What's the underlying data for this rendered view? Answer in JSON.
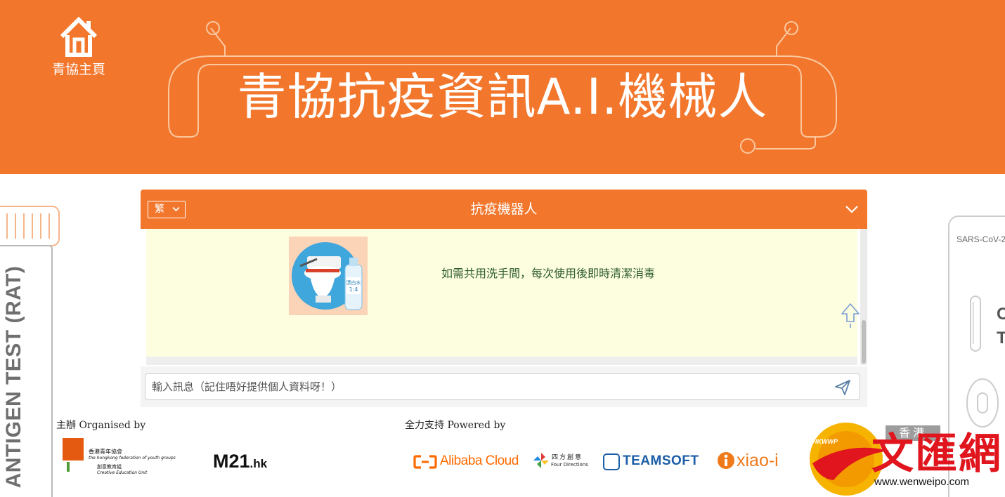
{
  "banner": {
    "home_label": "青協主頁",
    "title": "青協抗疫資訊A.I.機械人",
    "background": "#f2772d"
  },
  "chat": {
    "language": "繁",
    "title": "抗疫機器人",
    "message": {
      "image_badge": "漂白水",
      "image_ratio": "1:4",
      "text": "如需共用洗手間，每次使用後即時清潔消毒"
    },
    "input_placeholder": "輸入訊息（記住唔好提供個人資料呀！）"
  },
  "decor": {
    "left_vertical": "ANTIGEN TEST (RAT)",
    "right_label": "SARS-CoV-2",
    "right_c": "C",
    "right_t": "T"
  },
  "footer": {
    "organised_label": "主辦 Organised by",
    "powered_label": "全力支持 Powered by",
    "hkfyg_name_zh": "香港青年協會",
    "hkfyg_name_en": "the hongkong federation of youth groups",
    "hkfyg_unit_zh": "創意教育組",
    "hkfyg_unit_en": "Creative Education Unit",
    "m21": "M21",
    "m21_suffix": ".hk",
    "alibaba": "Alibaba Cloud",
    "fourdir_zh": "四方創意",
    "fourdir_en": "Four Directions",
    "teamsoft": "TEAMSOFT",
    "xiaoi": "xiao-i"
  },
  "watermark": {
    "region": "香港",
    "name": "文匯網",
    "url": "www.wenweipo.com",
    "tag": "HKWWP"
  }
}
